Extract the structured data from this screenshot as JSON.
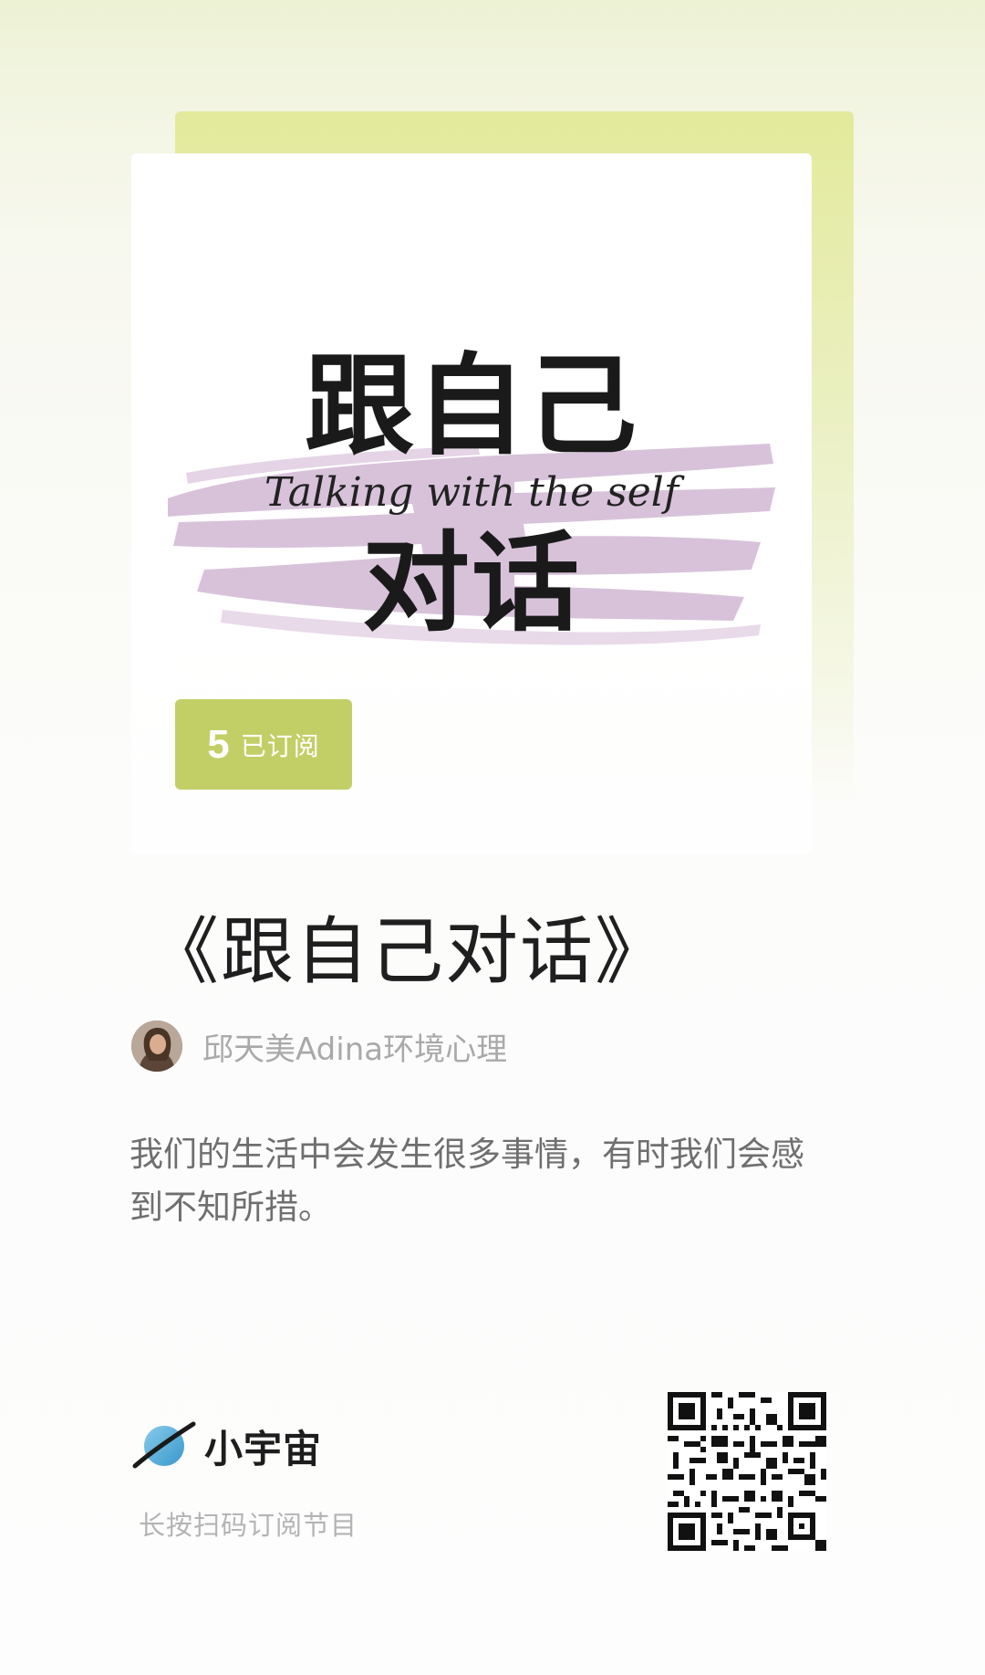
{
  "cover": {
    "title_top": "跟自己",
    "title_bottom": "对话",
    "script_text": "Talking with the self"
  },
  "subscription": {
    "count": "5",
    "label": "已订阅"
  },
  "program": {
    "title": "《跟自己对话》"
  },
  "author": {
    "name": "邱天美Adina环境心理"
  },
  "description": "我们的生活中会发生很多事情，有时我们会感到不知所措。",
  "brand": {
    "name": "小宇宙",
    "scan_hint": "长按扫码订阅节目"
  },
  "colors": {
    "accent": "#c2cf66",
    "brush": "#d6bfd8",
    "title_text": "#1f1f1f",
    "meta_text": "#a9a9a9",
    "brand_blue": "#49aee0"
  },
  "icons": {
    "brand_logo": "planet-icon",
    "avatar": "author-avatar",
    "qr": "qr-code"
  }
}
